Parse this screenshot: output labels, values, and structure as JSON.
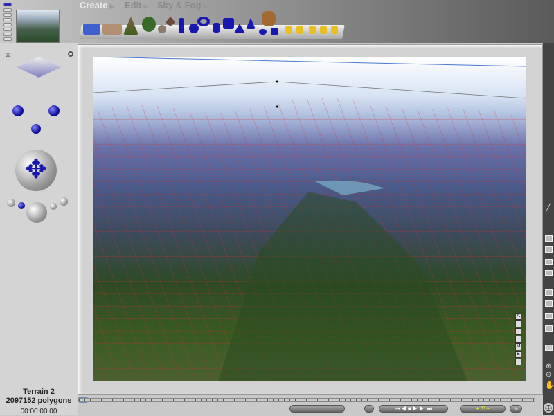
{
  "menu": {
    "create": "Create",
    "edit": "Edit",
    "sky_fog": "Sky & Fog"
  },
  "status": {
    "object_name": "Terrain 2",
    "polygons": "2097152 polygons",
    "time": "00:00:00.00"
  },
  "view_labels": [
    "A",
    "",
    "",
    "",
    "M",
    "E",
    ""
  ],
  "colors": {
    "wireframe": "#d03030",
    "object_blue": "#1818b0",
    "primitive_yellow": "#e8c020"
  }
}
